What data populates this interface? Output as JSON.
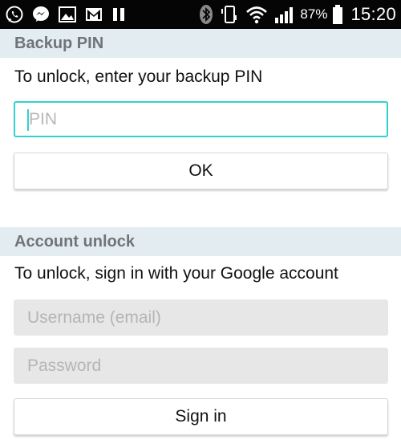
{
  "status_bar": {
    "icons_left": [
      "whatsapp-icon",
      "messenger-icon",
      "gallery-icon",
      "gmail-icon",
      "pause-icon"
    ],
    "icons_right": [
      "bluetooth-icon",
      "vibrate-icon",
      "wifi-icon",
      "signal-icon",
      "battery-icon"
    ],
    "battery_percent": "87%",
    "time": "15:20"
  },
  "backup_pin": {
    "header": "Backup PIN",
    "instruction": "To unlock, enter your backup PIN",
    "pin_placeholder": "PIN",
    "ok_label": "OK"
  },
  "account_unlock": {
    "header": "Account unlock",
    "instruction": "To unlock, sign in with your Google account",
    "username_placeholder": "Username (email)",
    "password_placeholder": "Password",
    "sign_in_label": "Sign in"
  },
  "colors": {
    "accent": "#33d0d0",
    "header_bg": "#e3ecf0",
    "header_text": "#6f7478",
    "input_disabled_bg": "#e7e7e7"
  }
}
